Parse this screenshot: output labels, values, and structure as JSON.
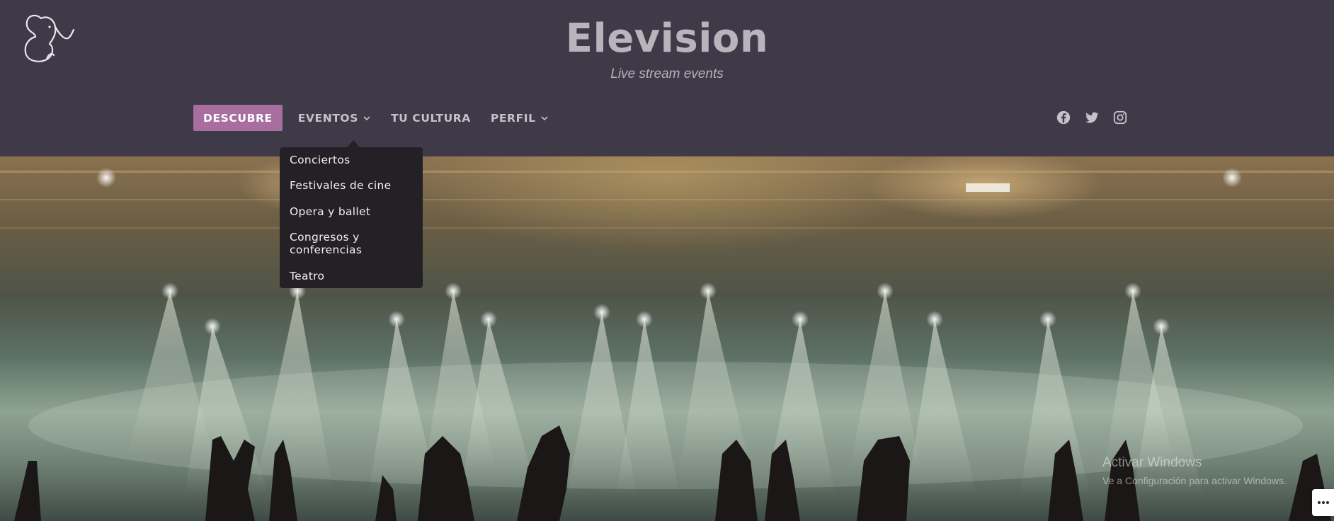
{
  "site": {
    "title": "Elevision",
    "tagline": "Live stream events"
  },
  "nav": {
    "items": [
      {
        "label": "DESCUBRE",
        "active": true,
        "dropdown": false
      },
      {
        "label": "EVENTOS",
        "active": false,
        "dropdown": true
      },
      {
        "label": "TU CULTURA",
        "active": false,
        "dropdown": false
      },
      {
        "label": "PERFIL",
        "active": false,
        "dropdown": true
      }
    ]
  },
  "dropdown": {
    "items": [
      "Conciertos",
      "Festivales de cine",
      "Opera y ballet",
      "Congresos y conferencias",
      "Teatro"
    ]
  },
  "social": [
    "facebook-icon",
    "twitter-icon",
    "instagram-icon"
  ],
  "watermark": {
    "title": "Activar Windows",
    "subtitle": "Ve a Configuración para activar Windows."
  },
  "colors": {
    "header_bg": "#3e3a48",
    "accent": "#a76e9f",
    "dropdown_bg": "#232125"
  }
}
